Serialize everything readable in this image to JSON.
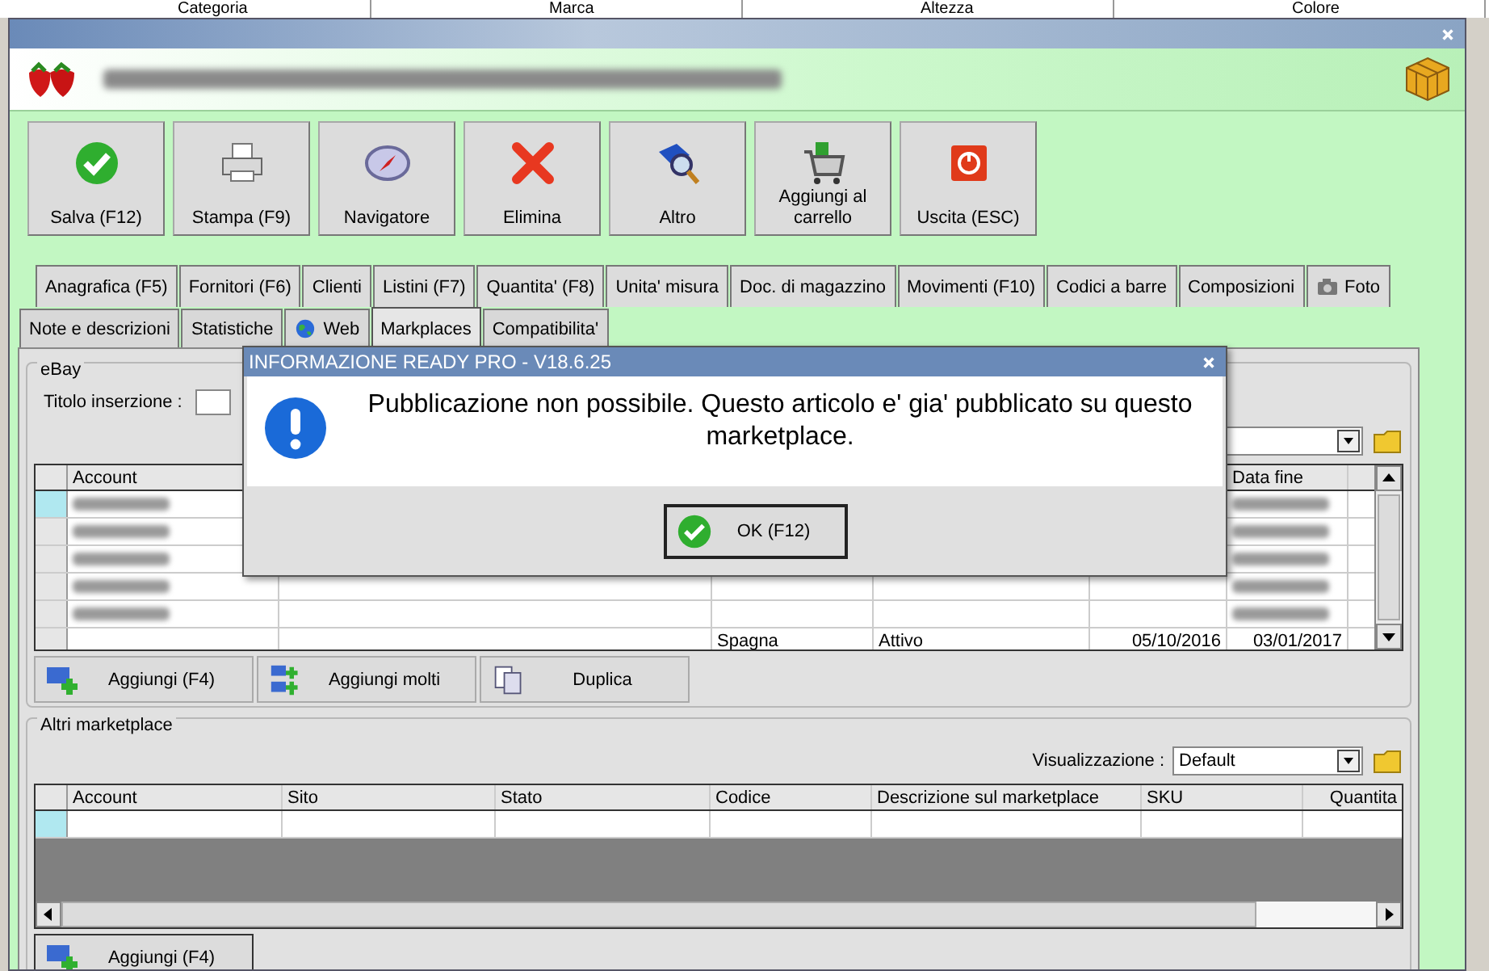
{
  "background_columns": [
    "Categoria",
    "Marca",
    "Altezza",
    "Colore"
  ],
  "toolbar": [
    {
      "label": "Salva (F12)"
    },
    {
      "label": "Stampa (F9)"
    },
    {
      "label": "Navigatore"
    },
    {
      "label": "Elimina"
    },
    {
      "label": "Altro"
    },
    {
      "label": "Aggiungi al carrello"
    },
    {
      "label": "Uscita (ESC)"
    }
  ],
  "tabs_row1": [
    {
      "label": "Anagrafica (F5)",
      "selected": false
    },
    {
      "label": "Fornitori (F6)",
      "selected": false
    },
    {
      "label": "Clienti",
      "selected": false
    },
    {
      "label": "Listini (F7)",
      "selected": false
    },
    {
      "label": "Quantita' (F8)",
      "selected": false
    },
    {
      "label": "Unita' misura",
      "selected": false
    },
    {
      "label": "Doc. di magazzino",
      "selected": false
    },
    {
      "label": "Movimenti (F10)",
      "selected": false
    },
    {
      "label": "Codici a barre",
      "selected": false
    },
    {
      "label": "Composizioni",
      "selected": false
    },
    {
      "label": "Foto",
      "selected": false
    }
  ],
  "tabs_row2": [
    {
      "label": "Note e descrizioni",
      "selected": false
    },
    {
      "label": "Statistiche",
      "selected": false
    },
    {
      "label": "Web",
      "selected": false
    },
    {
      "label": "Markplaces",
      "selected": true
    },
    {
      "label": "Compatibilita'",
      "selected": false
    }
  ],
  "ebay": {
    "title": "eBay",
    "listing_title_label": "Titolo inserzione :",
    "table": {
      "columns": [
        "Account",
        "Data fine"
      ],
      "rows": [
        {
          "selected": true
        },
        {
          "selected": false
        },
        {
          "selected": false
        },
        {
          "selected": false
        },
        {
          "selected": false
        },
        {
          "selected": false,
          "cells": [
            "Spagna",
            "Attivo",
            "05/10/2016",
            "03/01/2017"
          ]
        }
      ]
    },
    "buttons": [
      {
        "label": "Aggiungi (F4)"
      },
      {
        "label": "Aggiungi molti"
      },
      {
        "label": "Duplica"
      }
    ]
  },
  "other_marketplaces": {
    "title": "Altri marketplace",
    "view_label": "Visualizzazione :",
    "view_value": "Default",
    "table": {
      "columns": [
        "Account",
        "Sito",
        "Stato",
        "Codice",
        "Descrizione sul marketplace",
        "SKU",
        "Quantita"
      ],
      "rows": [
        {
          "selected": true
        }
      ]
    },
    "buttons": [
      {
        "label": "Aggiungi (F4)"
      }
    ]
  },
  "dialog": {
    "title": "INFORMAZIONE READY PRO - V18.6.25",
    "message": "Pubblicazione non possibile. Questo articolo e' gia' pubblicato su questo marketplace.",
    "button": "OK (F12)"
  }
}
